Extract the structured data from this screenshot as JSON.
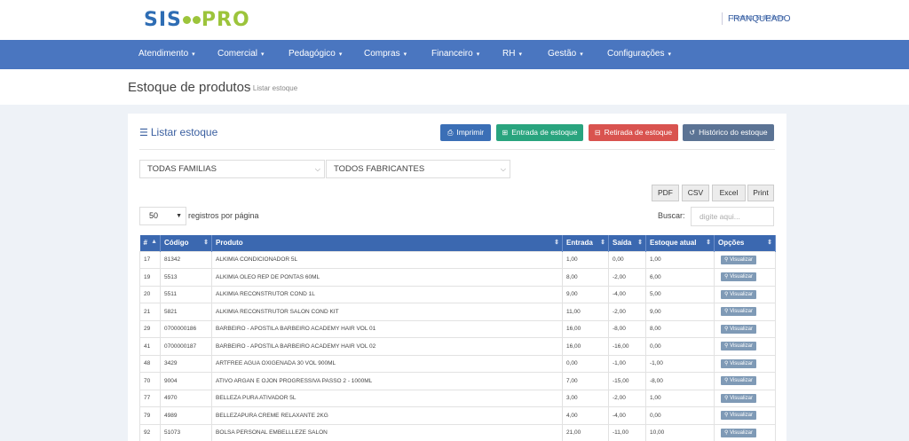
{
  "brand": {
    "part1": "SIS",
    "part2": "PRO"
  },
  "header": {
    "org": "Instituto Embelleze",
    "user": "FRANQUEADO"
  },
  "nav": [
    "Atendimento",
    "Comercial",
    "Pedagógico",
    "Compras",
    "Financeiro",
    "RH",
    "Gestão",
    "Configurações"
  ],
  "page": {
    "title": "Estoque de produtos",
    "breadcrumb": "› Listar estoque"
  },
  "card": {
    "title": "Listar estoque",
    "buttons": {
      "print": "Imprimir",
      "entrada": "Entrada de estoque",
      "retirada": "Retirada de estoque",
      "historico": "Histórico do estoque"
    }
  },
  "filters": {
    "familias": "TODAS FAMILIAS",
    "fabricantes": "TODOS FABRICANTES"
  },
  "export": {
    "pdf": "PDF",
    "csv": "CSV",
    "excel": "Excel",
    "print": "Print"
  },
  "paging": {
    "per_page": "50",
    "label": "registros por página"
  },
  "search": {
    "label": "Buscar:",
    "placeholder": "digite aqui..."
  },
  "table": {
    "columns": [
      "#",
      "Código",
      "Produto",
      "Entrada",
      "Saída",
      "Estoque atual",
      "Opções"
    ],
    "action_label": "Visualizar",
    "rows": [
      [
        "17",
        "81342",
        "ALKIMIA CONDICIONADOR 5L",
        "1,00",
        "0,00",
        "1,00"
      ],
      [
        "19",
        "5513",
        "ALKIMIA OLEO REP DE PONTAS 60ML",
        "8,00",
        "-2,00",
        "6,00"
      ],
      [
        "20",
        "5511",
        "ALKIMIA RECONSTRUTOR COND 1L",
        "9,00",
        "-4,00",
        "5,00"
      ],
      [
        "21",
        "5821",
        "ALKIMIA RECONSTRUTOR SALON COND KIT",
        "11,00",
        "-2,00",
        "9,00"
      ],
      [
        "29",
        "0700000186",
        "BARBEIRO - APOSTILA BARBEIRO ACADEMY HAIR VOL 01",
        "16,00",
        "-8,00",
        "8,00"
      ],
      [
        "41",
        "0700000187",
        "BARBEIRO - APOSTILA BARBEIRO ACADEMY HAIR VOL 02",
        "16,00",
        "-16,00",
        "0,00"
      ],
      [
        "48",
        "3429",
        "ARTFREE AGUA OXIGENADA 30 VOL 900ML",
        "0,00",
        "-1,00",
        "-1,00"
      ],
      [
        "70",
        "9004",
        "ATIVO ARGAN E OJON PROGRESSIVA PASSO 2 - 1000ML",
        "7,00",
        "-15,00",
        "-8,00"
      ],
      [
        "77",
        "4970",
        "BELLEZA PURA ATIVADOR 5L",
        "3,00",
        "-2,00",
        "1,00"
      ],
      [
        "79",
        "4989",
        "BELLEZAPURA CREME RELAXANTE 2KG",
        "4,00",
        "-4,00",
        "0,00"
      ],
      [
        "92",
        "51073",
        "BOLSA PERSONAL EMBELLLEZE SALON",
        "21,00",
        "-11,00",
        "10,00"
      ]
    ]
  }
}
